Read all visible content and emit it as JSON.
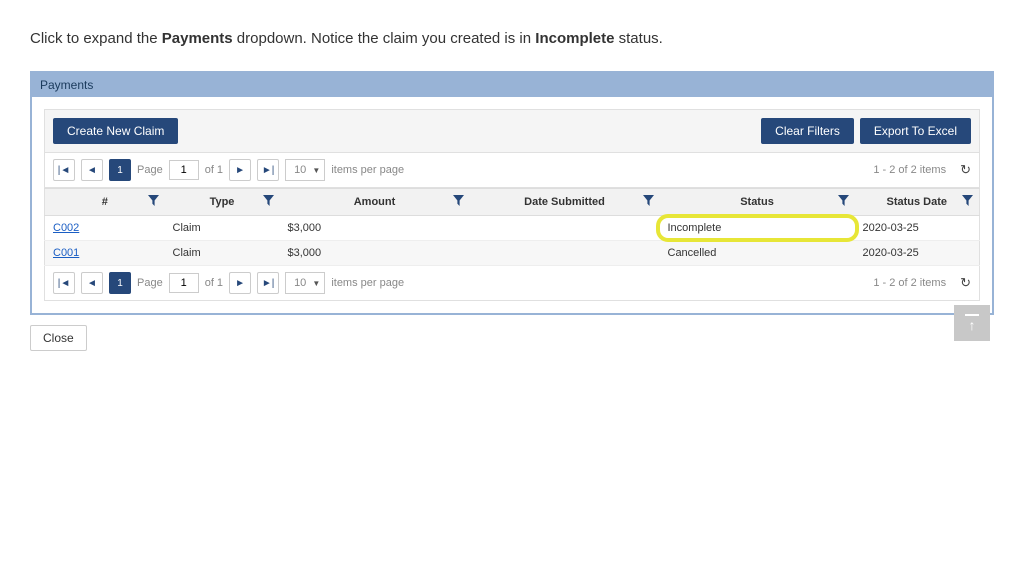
{
  "instruction": {
    "prefix": "Click to expand the ",
    "bold1": "Payments",
    "mid": " dropdown. Notice the claim you created is in ",
    "bold2": "Incomplete",
    "suffix": " status."
  },
  "panel": {
    "title": "Payments"
  },
  "toolbar": {
    "createLabel": "Create New Claim",
    "clearLabel": "Clear Filters",
    "exportLabel": "Export To Excel"
  },
  "pager": {
    "pageLabel": "Page",
    "pageValue": "1",
    "ofLabel": "of 1",
    "currentPage": "1",
    "pageSize": "10",
    "itemsPerPage": "items per page",
    "rangeText": "1 - 2 of 2 items"
  },
  "columns": {
    "id": "#",
    "type": "Type",
    "amount": "Amount",
    "dateSubmitted": "Date Submitted",
    "status": "Status",
    "statusDate": "Status Date"
  },
  "rows": [
    {
      "id": "C002",
      "type": "Claim",
      "amount": "$3,000",
      "dateSubmitted": "",
      "status": "Incomplete",
      "statusDate": "2020-03-25"
    },
    {
      "id": "C001",
      "type": "Claim",
      "amount": "$3,000",
      "dateSubmitted": "",
      "status": "Cancelled",
      "statusDate": "2020-03-25"
    }
  ],
  "closeLabel": "Close"
}
